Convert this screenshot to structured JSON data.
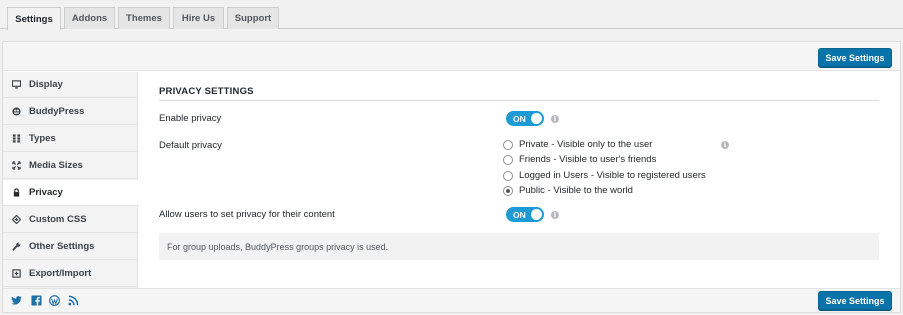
{
  "tabs": [
    {
      "label": "Settings",
      "active": true
    },
    {
      "label": "Addons",
      "active": false
    },
    {
      "label": "Themes",
      "active": false
    },
    {
      "label": "Hire Us",
      "active": false
    },
    {
      "label": "Support",
      "active": false
    }
  ],
  "save_button_label": "Save Settings",
  "sidebar": {
    "items": [
      {
        "label": "Display",
        "icon": "monitor-icon"
      },
      {
        "label": "BuddyPress",
        "icon": "buddypress-icon"
      },
      {
        "label": "Types",
        "icon": "grid-icon"
      },
      {
        "label": "Media Sizes",
        "icon": "resize-icon"
      },
      {
        "label": "Privacy",
        "icon": "lock-icon",
        "active": true
      },
      {
        "label": "Custom CSS",
        "icon": "css-icon"
      },
      {
        "label": "Other Settings",
        "icon": "wrench-icon"
      },
      {
        "label": "Export/Import",
        "icon": "export-icon"
      }
    ]
  },
  "content": {
    "section_title": "PRIVACY SETTINGS",
    "enable_privacy": {
      "label": "Enable privacy",
      "toggle": "ON"
    },
    "default_privacy": {
      "label": "Default privacy",
      "options": [
        {
          "label": "Private - Visible only to the user",
          "checked": false
        },
        {
          "label": "Friends - Visible to user's friends",
          "checked": false
        },
        {
          "label": "Logged in Users - Visible to registered users",
          "checked": false
        },
        {
          "label": "Public - Visible to the world",
          "checked": true
        }
      ]
    },
    "allow_users": {
      "label": "Allow users to set privacy for their content",
      "toggle": "ON"
    },
    "notice": "For group uploads, BuddyPress groups privacy is used.",
    "info_glyph": "i"
  },
  "footer": {
    "social_icons": [
      "twitter-icon",
      "facebook-icon",
      "wordpress-icon",
      "rss-icon"
    ]
  },
  "colors": {
    "accent": "#1e9bd5",
    "button": "#0a73aa"
  }
}
